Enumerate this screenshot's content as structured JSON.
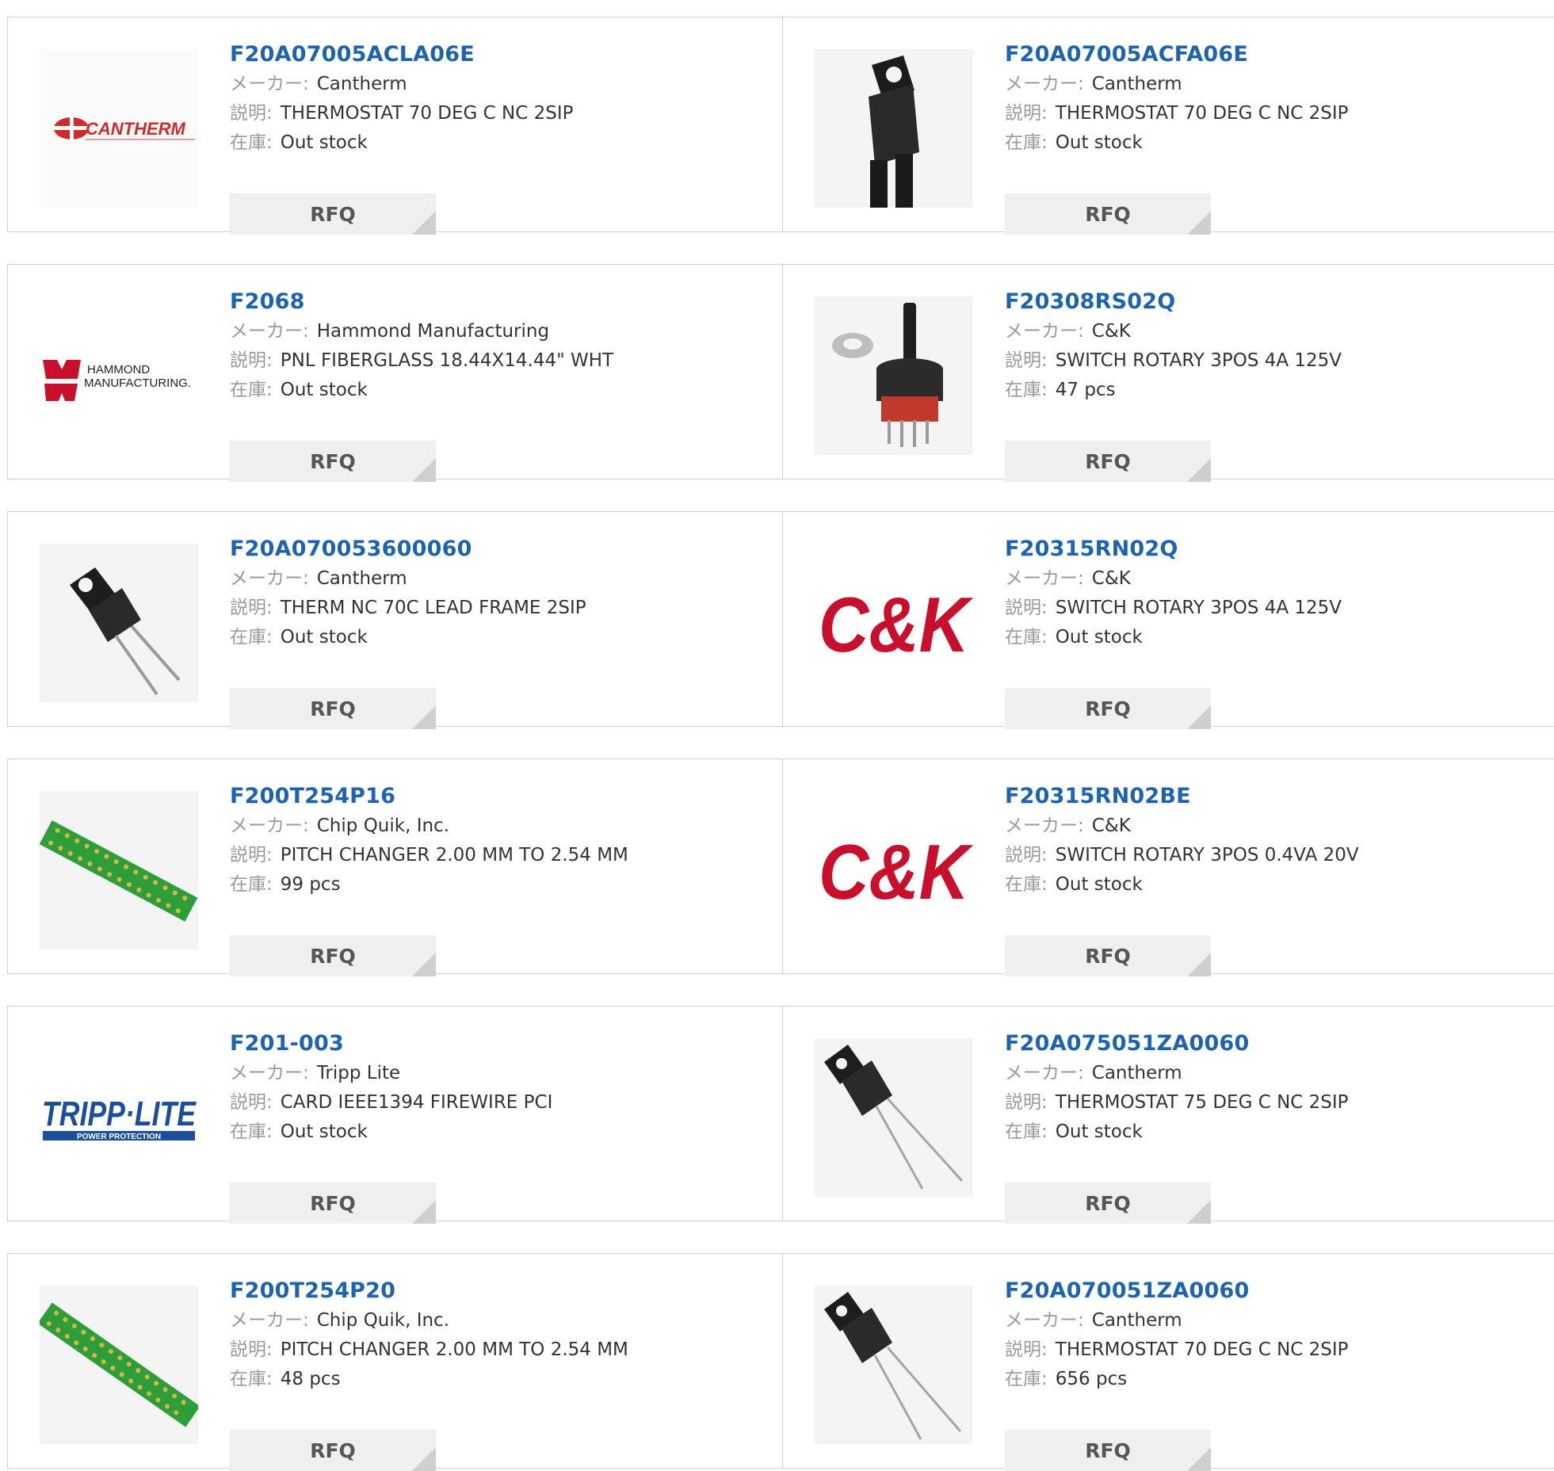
{
  "labels": {
    "manufacturer": "メーカー:",
    "description": "説明:",
    "stock": "在庫:",
    "rfq": "RFQ"
  },
  "colors": {
    "link": "#1e63b0",
    "border": "#cfcfcf",
    "button_bg": "#efefef"
  },
  "products": [
    {
      "pn": "F20A07005ACLA06E",
      "mfr": "Cantherm",
      "desc": "THERMOSTAT 70 DEG C NC 2SIP",
      "stock": "Out stock",
      "image": "cantherm-logo",
      "logo_text": "CANTHERM"
    },
    {
      "pn": "F20A07005ACFA06E",
      "mfr": "Cantherm",
      "desc": "THERMOSTAT 70 DEG C NC 2SIP",
      "stock": "Out stock",
      "image": "thermostat-black-lead"
    },
    {
      "pn": "F2068",
      "mfr": "Hammond Manufacturing",
      "desc": "PNL FIBERGLASS 18.44X14.44\" WHT",
      "stock": "Out stock",
      "image": "hammond-logo",
      "logo_text_1": "HAMMOND",
      "logo_text_2": "MANUFACTURING."
    },
    {
      "pn": "F20308RS02Q",
      "mfr": "C&K",
      "desc": "SWITCH ROTARY 3POS 4A 125V",
      "stock": "47 pcs",
      "image": "rotary-switch-photo"
    },
    {
      "pn": "F20A070053600060",
      "mfr": "Cantherm",
      "desc": "THERM NC 70C LEAD FRAME 2SIP",
      "stock": "Out stock",
      "image": "thermostat-two-pin"
    },
    {
      "pn": "F20315RN02Q",
      "mfr": "C&K",
      "desc": "SWITCH ROTARY 3POS 4A 125V",
      "stock": "Out stock",
      "image": "ck-logo",
      "logo_text": "C&K"
    },
    {
      "pn": "F200T254P16",
      "mfr": "Chip Quik, Inc.",
      "desc": "PITCH CHANGER 2.00 MM TO 2.54 MM",
      "stock": "99 pcs",
      "image": "pcb-adapter"
    },
    {
      "pn": "F20315RN02BE",
      "mfr": "C&K",
      "desc": "SWITCH ROTARY 3POS 0.4VA 20V",
      "stock": "Out stock",
      "image": "ck-logo",
      "logo_text": "C&K"
    },
    {
      "pn": "F201-003",
      "mfr": "Tripp Lite",
      "desc": "CARD IEEE1394 FIREWIRE PCI",
      "stock": "Out stock",
      "image": "tripp-lite-logo",
      "logo_text_1": "TRIPP·LITE",
      "logo_text_2": "POWER PROTECTION"
    },
    {
      "pn": "F20A075051ZA0060",
      "mfr": "Cantherm",
      "desc": "THERMOSTAT 75 DEG C NC 2SIP",
      "stock": "Out stock",
      "image": "thermostat-long-lead"
    },
    {
      "pn": "F200T254P20",
      "mfr": "Chip Quik, Inc.",
      "desc": "PITCH CHANGER 2.00 MM TO 2.54 MM",
      "stock": "48 pcs",
      "image": "pcb-adapter"
    },
    {
      "pn": "F20A070051ZA0060",
      "mfr": "Cantherm",
      "desc": "THERMOSTAT 70 DEG C NC 2SIP",
      "stock": "656 pcs",
      "image": "thermostat-long-lead"
    }
  ]
}
